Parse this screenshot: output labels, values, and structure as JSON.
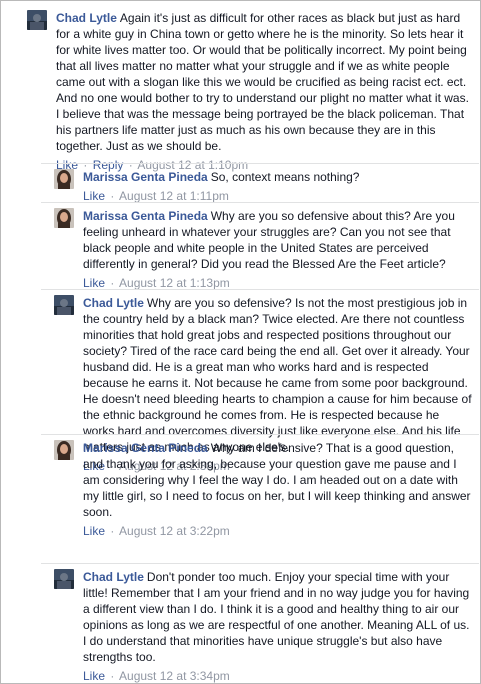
{
  "comments": [
    {
      "author": "Chad Lytle",
      "text": "Again it's just as difficult for other races as black but just as hard for a white guy in China town or getto where he is the minority. So lets hear it for white lives matter too. Or would that be politically incorrect. My point being that all lives matter no matter what your struggle and if we as white people came out with a slogan like this we would be crucified as being racist ect. ect. And no one would bother to try to understand our plight no matter what it was. I believe that was the message being portrayed be the black policeman. That his partners life matter just as much as his own because they are in this together. Just as we should be.",
      "like": "Like",
      "reply": "Reply",
      "dot": "·",
      "time": "August 12 at 1:10pm"
    },
    {
      "author": "Marissa Genta Pineda",
      "text": "So, context means nothing?",
      "like": "Like",
      "dot": "·",
      "time": "August 12 at 1:11pm"
    },
    {
      "author": "Marissa Genta Pineda",
      "text": "Why are you so defensive about this? Are you feeling unheard in whatever your struggles are? Can you not see that black people and white people in the United States are perceived differently in general? Did you read the Blessed Are the Feet article?",
      "like": "Like",
      "dot": "·",
      "time": "August 12 at 1:13pm"
    },
    {
      "author": "Chad Lytle",
      "text": "Why are you so defensive? Is not the most prestigious job in the country held by a black man? Twice elected. Are there not countless minorities that hold great jobs and respected positions throughout our society? Tired of the race card being the end all. Get over it already. Your husband did. He is a great man who works hard and is respected because he earns it. Not because he came from some poor background. He doesn't need bleeding hearts to champion a cause for him because of the ethnic background he comes from. He is respected because he works hard and overcomes diversity just like everyone else. And his life matters just as much as anyone else's.",
      "like": "Like",
      "dot": "·",
      "time": "August 12 at 2:38pm"
    },
    {
      "author": "Marissa Genta Pineda",
      "text": "Why am I defensive? That is a good question, and thank you for asking, because your question gave me pause and I am considering why I feel the way I do. I am headed out on a date with my little girl, so I need to focus on her, but I will keep thinking and answer soon.",
      "like": "Like",
      "dot": "·",
      "time": "August 12 at 3:22pm"
    },
    {
      "author": "Chad Lytle",
      "text": "Don't ponder too much. Enjoy your special time with your little! Remember that I am your friend and in no way judge you for having a different view than I do. I think it is a good and healthy thing to air our opinions as long as we are respectful of one another. Meaning ALL of us. I do understand that minorities have unique struggle's but also have strengths too.",
      "like": "Like",
      "dot": "·",
      "time": "August 12 at 3:34pm"
    }
  ]
}
